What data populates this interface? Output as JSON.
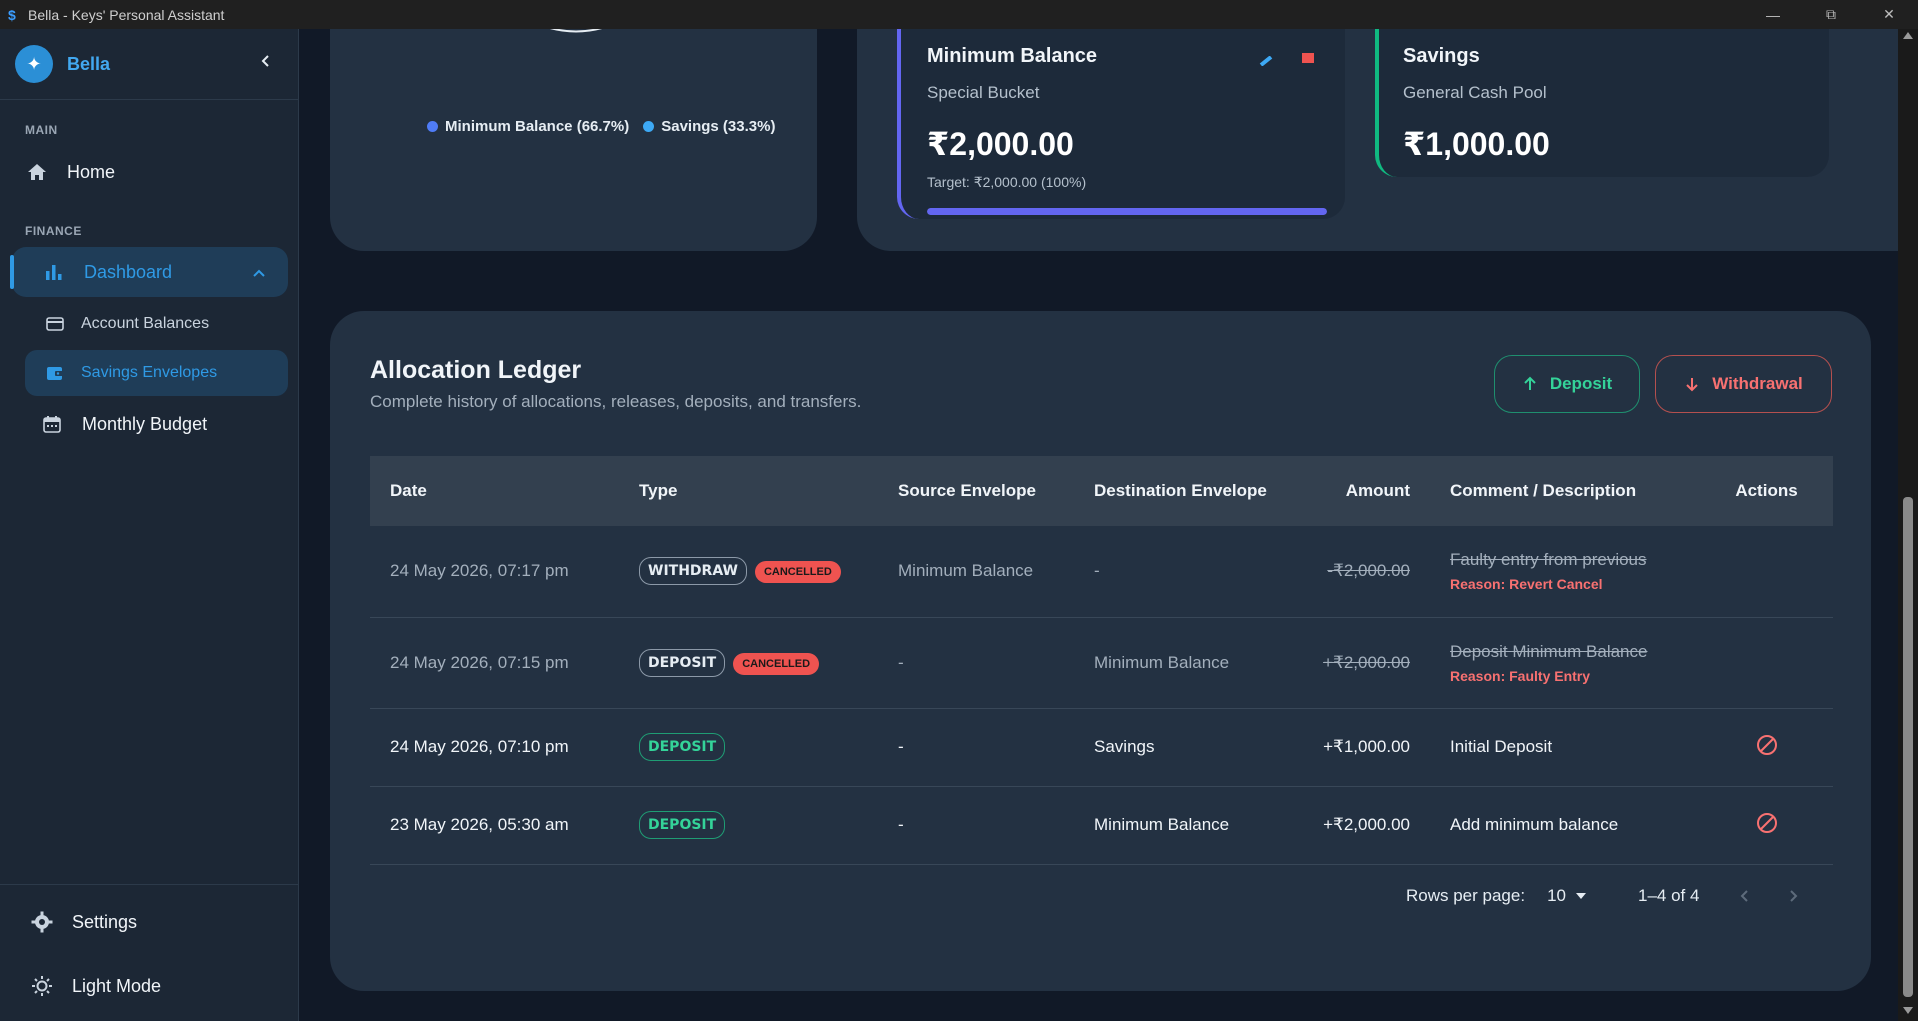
{
  "window": {
    "title": "Bella - Keys' Personal Assistant"
  },
  "sidebar": {
    "brand": "Bella",
    "section_main": "MAIN",
    "section_finance": "FINANCE",
    "home": "Home",
    "dashboard": "Dashboard",
    "account_balances": "Account Balances",
    "savings_envelopes": "Savings Envelopes",
    "monthly_budget": "Monthly Budget",
    "settings": "Settings",
    "light_mode": "Light Mode"
  },
  "chart_legend": [
    {
      "label": "Minimum Balance (66.7%)",
      "color": "#4f7cf7",
      "share": 66.7
    },
    {
      "label": "Savings (33.3%)",
      "color": "#3da9f5",
      "share": 33.3
    }
  ],
  "envelopes": [
    {
      "title": "Minimum Balance",
      "subtitle": "Special Bucket",
      "amount": "₹2,000.00",
      "target": "Target: ₹2,000.00 (100%)",
      "progress": 1.0,
      "accent": "#6366f1"
    },
    {
      "title": "Savings",
      "subtitle": "General Cash Pool",
      "amount": "₹1,000.00",
      "accent": "#10b981"
    }
  ],
  "ledger": {
    "title": "Allocation Ledger",
    "subtitle": "Complete history of allocations, releases, deposits, and transfers.",
    "deposit_label": "Deposit",
    "withdrawal_label": "Withdrawal",
    "columns": [
      "Date",
      "Type",
      "Source Envelope",
      "Destination Envelope",
      "Amount",
      "Comment / Description",
      "Actions"
    ],
    "rows": [
      {
        "date": "24 May 2026, 07:17 pm",
        "type": "WITHDRAW",
        "status": "CANCELLED",
        "source": "Minimum Balance",
        "destination": "-",
        "amount": "-₹2,000.00",
        "comment": "Faulty entry from previous",
        "reason": "Reason: Revert Cancel"
      },
      {
        "date": "24 May 2026, 07:15 pm",
        "type": "DEPOSIT",
        "status": "CANCELLED",
        "source": "-",
        "destination": "Minimum Balance",
        "amount": "+₹2,000.00",
        "comment": "Deposit Minimum Balance",
        "reason": "Reason: Faulty Entry"
      },
      {
        "date": "24 May 2026, 07:10 pm",
        "type": "DEPOSIT",
        "source": "-",
        "destination": "Savings",
        "amount": "+₹1,000.00",
        "comment": "Initial Deposit"
      },
      {
        "date": "23 May 2026, 05:30 am",
        "type": "DEPOSIT",
        "source": "-",
        "destination": "Minimum Balance",
        "amount": "+₹2,000.00",
        "comment": "Add minimum balance"
      }
    ],
    "rows_per_page_label": "Rows per page:",
    "rows_per_page": "10",
    "range": "1–4 of 4"
  }
}
